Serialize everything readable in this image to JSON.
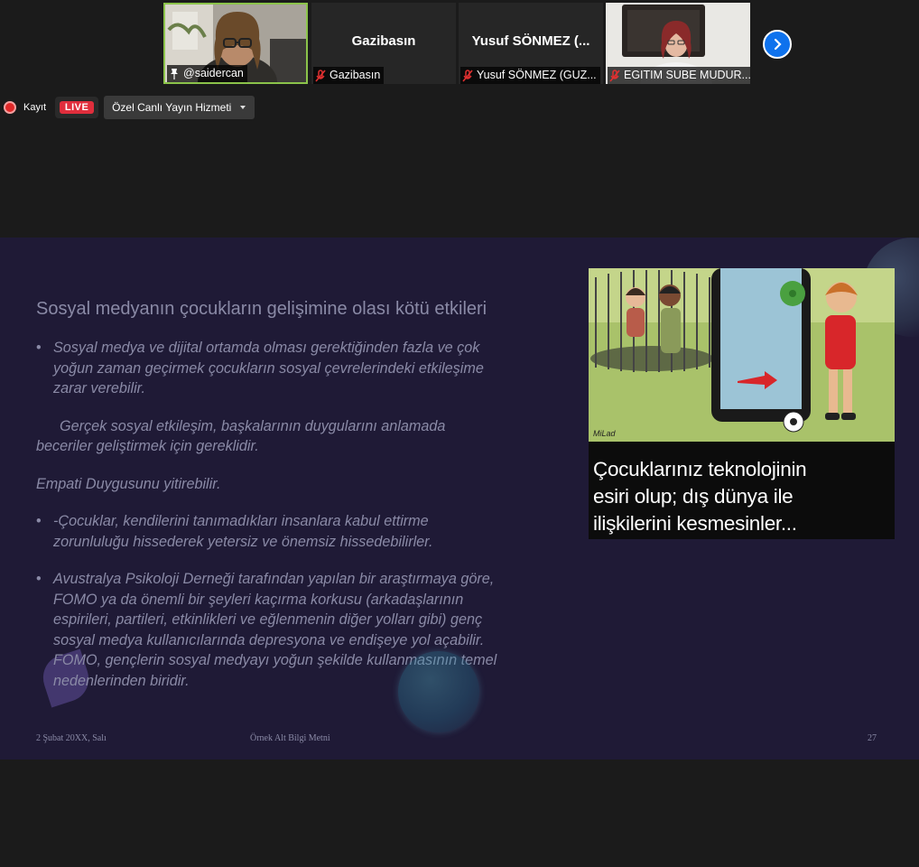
{
  "participants": [
    {
      "name": "@saidercan",
      "display": "",
      "video": true,
      "active": true,
      "muted": false
    },
    {
      "name": "Gazibasın",
      "display": "Gazibasın",
      "video": false,
      "active": false,
      "muted": true
    },
    {
      "name": "Yusuf SÖNMEZ (GUZ...",
      "display": "Yusuf  SÖNMEZ  (...",
      "video": false,
      "active": false,
      "muted": true
    },
    {
      "name": "EGITIM SUBE MUDUR...",
      "display": "",
      "video": true,
      "active": false,
      "muted": true
    }
  ],
  "recording": {
    "label": "Kayıt",
    "live": "LIVE",
    "stream_service": "Özel Canlı Yayın Hizmeti"
  },
  "slide": {
    "title": "Sosyal medyanın çocukların gelişimine olası kötü etkileri",
    "paragraphs": [
      {
        "bullet": true,
        "text": "Sosyal medya ve dijital ortamda olması gerektiğinden fazla ve çok yoğun zaman geçirmek çocukların sosyal çevrelerindeki etkileşime zarar verebilir."
      },
      {
        "bullet": false,
        "text": "Gerçek sosyal etkileşim, başkalarının duygularını anlamada beceriler geliştirmek için gereklidir."
      },
      {
        "bullet": false,
        "text": "Empati Duygusunu yitirebilir."
      },
      {
        "bullet": true,
        "text": "-Çocuklar, kendilerini tanımadıkları insanlara kabul ettirme zorunluluğu hissederek yetersiz ve önemsiz hissedebilirler."
      },
      {
        "bullet": true,
        "text": "Avustralya Psikoloji Derneği tarafından yapılan bir araştırmaya göre, FOMO ya da önemli bir şeyleri kaçırma korkusu (arkadaşlarının espirileri, partileri, etkinlikleri ve eğlenmenin diğer yolları gibi) genç sosyal medya kullanıcılarında depresyona ve endişeye yol açabilir. FOMO, gençlerin sosyal medyayı yoğun şekilde kullanmasının temel nedenlerinden biridir."
      }
    ],
    "image_caption": [
      "Çocuklarınız teknolojinin",
      "esiri olup; dış dünya ile",
      "ilişkilerini kesmesinler..."
    ],
    "image_signature": "MiLad",
    "footer": {
      "date": "2 Şubat 20XX, Salı",
      "text": "Örnek Alt Bilgi Metni",
      "page": "27"
    }
  },
  "colors": {
    "accent": "#0e72ed",
    "slide_bg": "#1f1a36",
    "slide_text": "#8a8aa6",
    "live": "#e02e3c",
    "active_border": "#8bc34a"
  },
  "icons": {
    "next": "chevron-right-icon",
    "pin": "pin-icon",
    "muted": "mic-muted-icon",
    "record": "record-icon",
    "dropdown": "caret-down-icon"
  }
}
